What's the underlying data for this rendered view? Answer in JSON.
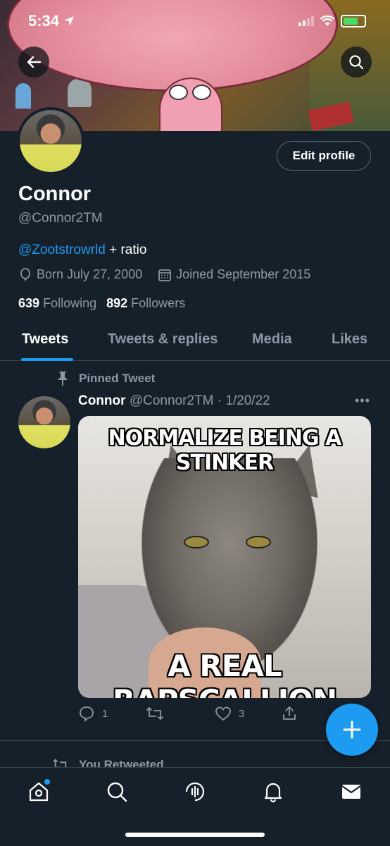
{
  "status_bar": {
    "time": "5:34"
  },
  "profile": {
    "name": "Connor",
    "handle": "@Connor2TM",
    "edit_label": "Edit profile",
    "bio_mention": "@Zootstrowrld",
    "bio_text": " + ratio",
    "born": "Born July 27, 2000",
    "joined": "Joined September 2015",
    "following_count": "639",
    "following_label": "Following",
    "followers_count": "892",
    "followers_label": "Followers"
  },
  "tabs": [
    {
      "label": "Tweets",
      "active": true
    },
    {
      "label": "Tweets & replies",
      "active": false
    },
    {
      "label": "Media",
      "active": false
    },
    {
      "label": "Likes",
      "active": false
    }
  ],
  "pinned_tweet": {
    "pinned_label": "Pinned Tweet",
    "author": "Connor",
    "handle_date": "@Connor2TM · 1/20/22",
    "meme_top": "NORMALIZE BEING A STINKER",
    "meme_bottom": "A REAL RAPSCALLION",
    "reply_count": "1",
    "retweet_count": "",
    "like_count": "3"
  },
  "next_item": {
    "retweeted_label": "You Retweeted"
  },
  "icons": {
    "back": "arrow-left-icon",
    "search": "search-icon",
    "pin": "pin-icon",
    "birthday": "balloon-icon",
    "calendar": "calendar-icon",
    "reply": "reply-icon",
    "retweet": "retweet-icon",
    "like": "heart-icon",
    "share": "share-icon",
    "compose": "plus-icon",
    "nav": [
      "home-icon",
      "search-icon",
      "spaces-icon",
      "notifications-icon",
      "messages-icon"
    ]
  },
  "colors": {
    "accent": "#1d9bf0",
    "background": "#15202b",
    "muted": "#8b98a5"
  }
}
